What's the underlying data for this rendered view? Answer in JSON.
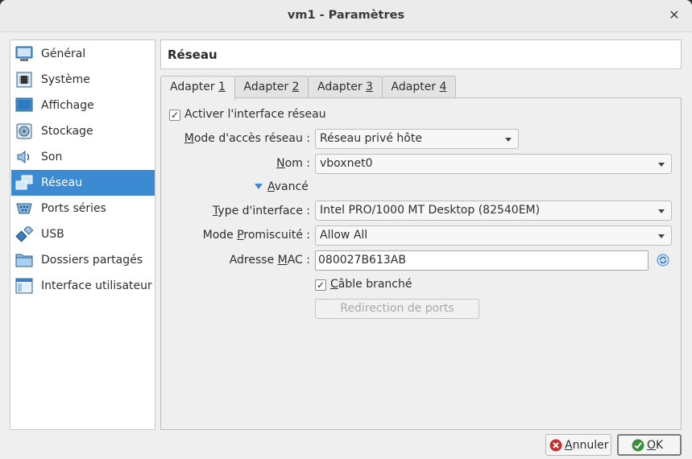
{
  "window": {
    "title": "vm1 - Paramètres",
    "close_glyph": "✕"
  },
  "sidebar": {
    "items": [
      {
        "label": "Général",
        "icon": "monitor-icon"
      },
      {
        "label": "Système",
        "icon": "chip-icon"
      },
      {
        "label": "Affichage",
        "icon": "display-icon"
      },
      {
        "label": "Stockage",
        "icon": "disk-icon"
      },
      {
        "label": "Son",
        "icon": "speaker-icon"
      },
      {
        "label": "Réseau",
        "icon": "network-icon",
        "active": true
      },
      {
        "label": "Ports séries",
        "icon": "serial-port-icon"
      },
      {
        "label": "USB",
        "icon": "usb-icon"
      },
      {
        "label": "Dossiers partagés",
        "icon": "folder-icon"
      },
      {
        "label": "Interface utilisateur",
        "icon": "window-icon"
      }
    ],
    "active_color": "#3c8ad1"
  },
  "section_title": "Réseau",
  "tabs": [
    {
      "pre": "Adapter ",
      "key": "1",
      "active": true
    },
    {
      "pre": "Adapter ",
      "key": "2"
    },
    {
      "pre": "Adapter ",
      "key": "3"
    },
    {
      "pre": "Adapter ",
      "key": "4"
    }
  ],
  "adapter": {
    "enable_label": "Activer l'interface réseau",
    "enable_checked": true,
    "attached_label_pre": "",
    "attached_label_key": "M",
    "attached_label_post": "ode d'accès réseau :",
    "attached_value": "Réseau privé hôte",
    "name_label_pre": "",
    "name_label_key": "N",
    "name_label_post": "om :",
    "name_value": "vboxnet0",
    "advanced_pre": "",
    "advanced_key": "A",
    "advanced_post": "vancé",
    "type_label_pre": "",
    "type_label_key": "T",
    "type_label_post": "ype d'interface :",
    "type_value": "Intel PRO/1000 MT Desktop (82540EM)",
    "promisc_label_pre": "Mode ",
    "promisc_label_key": "P",
    "promisc_label_post": "romiscuité :",
    "promisc_value": "Allow All",
    "mac_label_pre": "Adresse ",
    "mac_label_key": "M",
    "mac_label_post": "AC :",
    "mac_value": "080027B613AB",
    "cable_pre": "",
    "cable_key": "C",
    "cable_post": "âble branché",
    "cable_checked": true,
    "port_forwarding_label": "Redirection de ports"
  },
  "footer": {
    "cancel_key": "A",
    "cancel_post": "nnuler",
    "ok_key": "O",
    "ok_post": "K"
  },
  "colors": {
    "accent": "#3c8ad1",
    "cancel_red": "#c9302c",
    "ok_green": "#3a8f3a"
  }
}
